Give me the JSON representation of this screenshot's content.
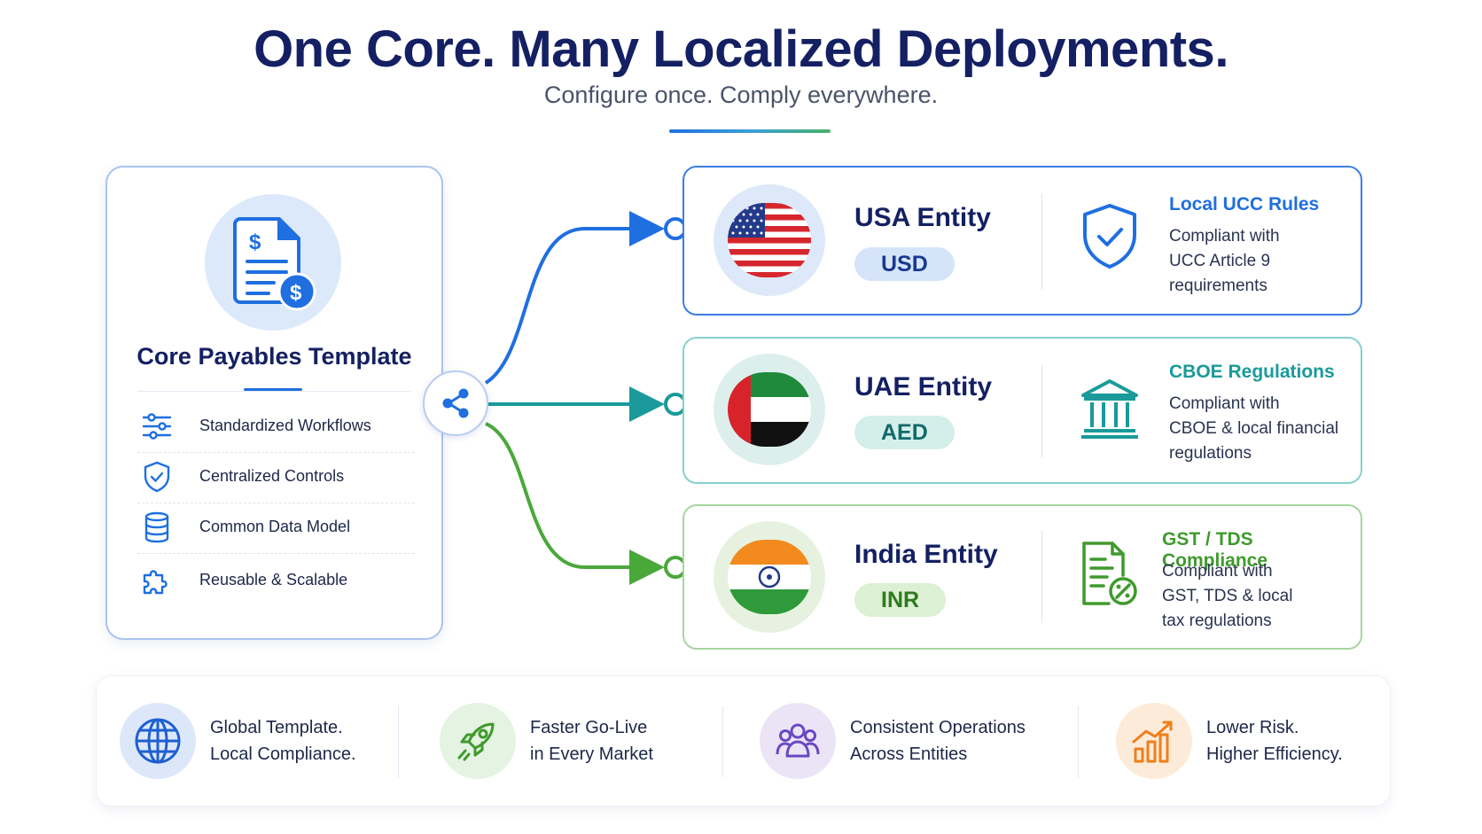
{
  "header": {
    "title": "One Core. Many Localized Deployments.",
    "subtitle": "Configure once. Comply everywhere."
  },
  "core": {
    "title": "Core Payables Template",
    "features": [
      {
        "label": "Standardized Workflows",
        "icon": "sliders-icon"
      },
      {
        "label": "Centralized Controls",
        "icon": "shield-check-icon"
      },
      {
        "label": "Common Data Model",
        "icon": "database-icon"
      },
      {
        "label": "Reusable & Scalable",
        "icon": "puzzle-icon"
      }
    ],
    "hub_icon": "share-icon"
  },
  "entities": [
    {
      "name": "USA Entity",
      "currency": "USD",
      "flag": "us-flag-icon",
      "reg_title": "Local UCC Rules",
      "reg_lines": [
        "Compliant with",
        "UCC Article 9",
        "requirements"
      ],
      "accent": "#1f6fe0",
      "reg_icon": "shield-check-icon"
    },
    {
      "name": "UAE Entity",
      "currency": "AED",
      "flag": "uae-flag-icon",
      "reg_title": "CBOE Regulations",
      "reg_lines": [
        "Compliant with",
        "CBOE & local financial",
        "regulations"
      ],
      "accent": "#1a9a9a",
      "reg_icon": "bank-icon"
    },
    {
      "name": "India Entity",
      "currency": "INR",
      "flag": "india-flag-icon",
      "reg_title": "GST / TDS Compliance",
      "reg_lines": [
        "Compliant with",
        "GST, TDS & local",
        "tax regulations"
      ],
      "accent": "#3f9a2d",
      "reg_icon": "tax-document-icon"
    }
  ],
  "benefits": [
    {
      "line1": "Global Template.",
      "line2": "Local Compliance.",
      "icon": "globe-icon"
    },
    {
      "line1": "Faster Go-Live",
      "line2": "in Every Market",
      "icon": "rocket-icon"
    },
    {
      "line1": "Consistent Operations",
      "line2": "Across Entities",
      "icon": "team-icon"
    },
    {
      "line1": "Lower Risk.",
      "line2": "Higher Efficiency.",
      "icon": "growth-chart-icon"
    }
  ]
}
